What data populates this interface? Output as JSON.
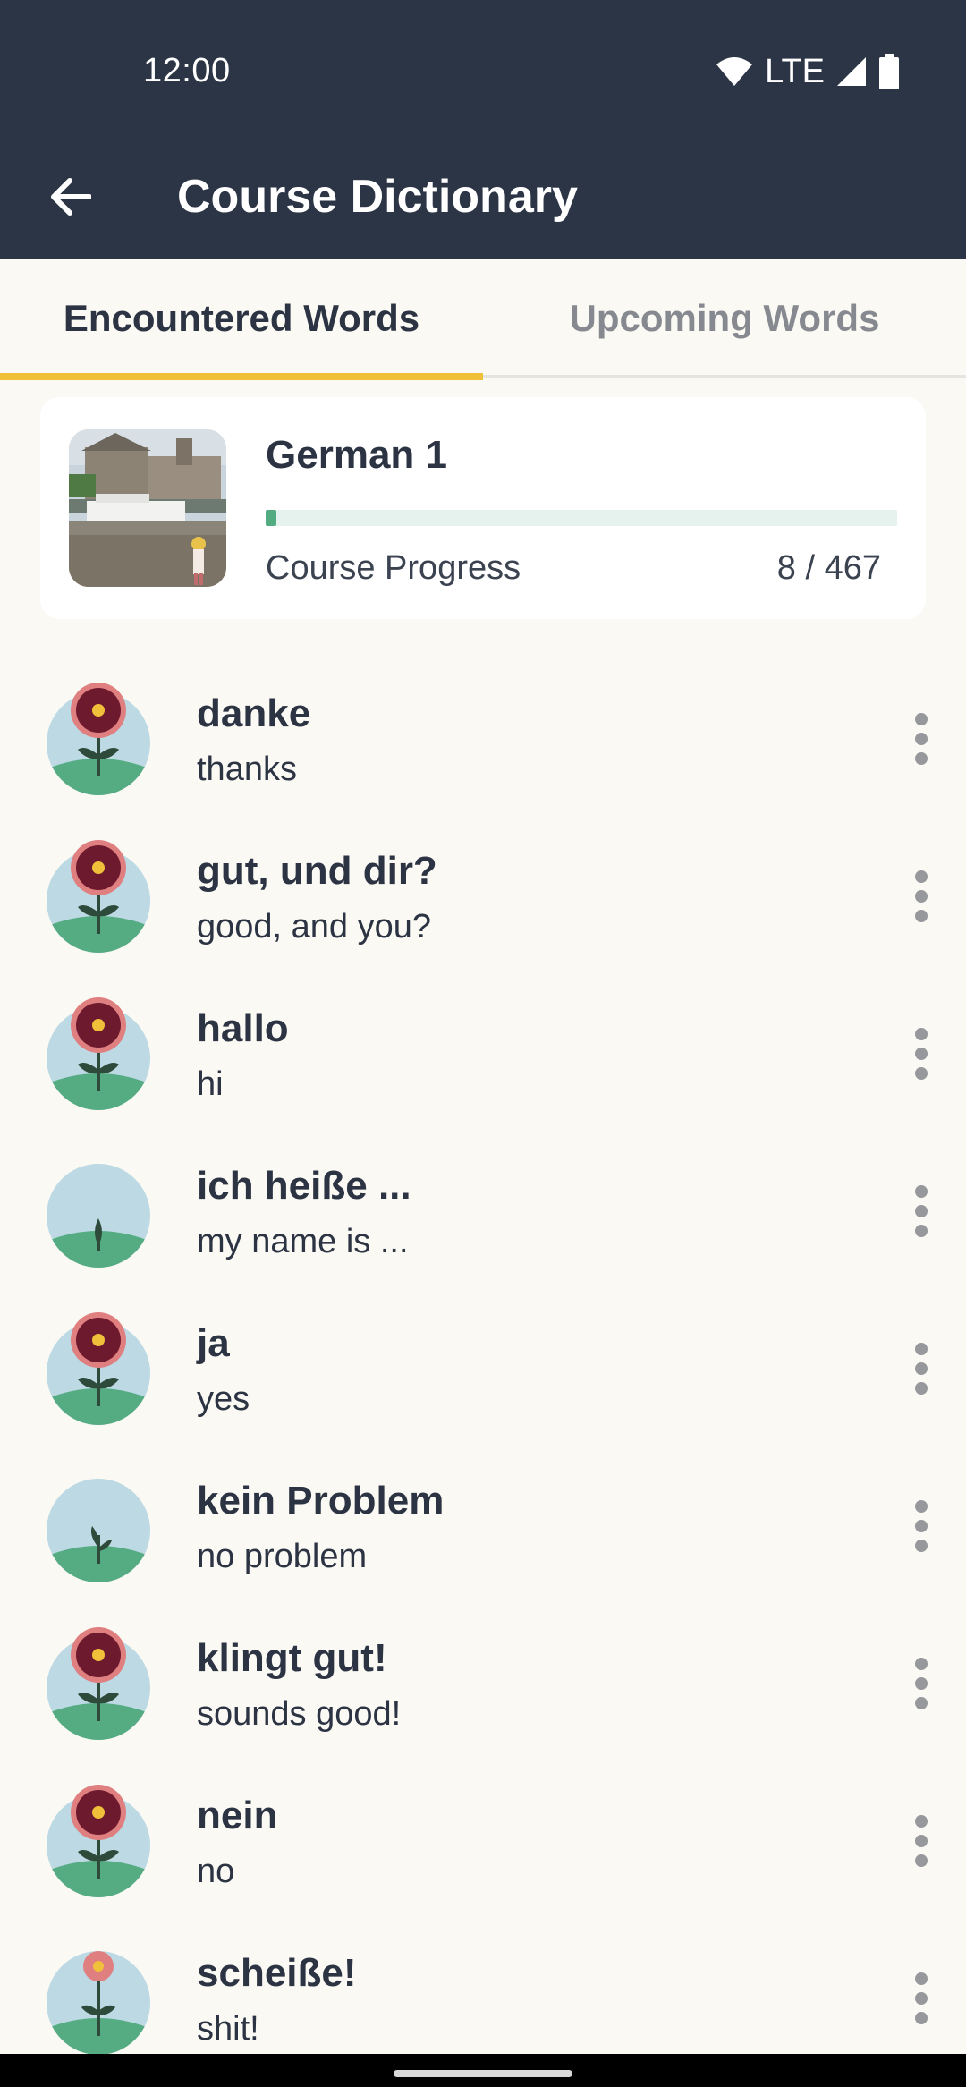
{
  "status_bar": {
    "time": "12:00",
    "network": "LTE",
    "icons": [
      "wifi-icon",
      "signal-icon",
      "battery-icon"
    ]
  },
  "app_bar": {
    "title": "Course Dictionary",
    "back_icon": "arrow-left-icon"
  },
  "tabs": [
    {
      "label": "Encountered Words",
      "active": true
    },
    {
      "label": "Upcoming Words",
      "active": false
    }
  ],
  "course": {
    "title": "German 1",
    "progress_label": "Course Progress",
    "progress_text": "8 / 467",
    "progress_fraction": 0.0171
  },
  "words": [
    {
      "term": "danke",
      "translation": "thanks",
      "stage": "flower"
    },
    {
      "term": "gut, und dir?",
      "translation": "good, and you?",
      "stage": "flower"
    },
    {
      "term": "hallo",
      "translation": "hi",
      "stage": "flower"
    },
    {
      "term": "ich heiße ...",
      "translation": "my name is ...",
      "stage": "sprout"
    },
    {
      "term": "ja",
      "translation": "yes",
      "stage": "flower"
    },
    {
      "term": "kein Problem",
      "translation": "no problem",
      "stage": "seedling"
    },
    {
      "term": "klingt gut!",
      "translation": "sounds good!",
      "stage": "flower"
    },
    {
      "term": "nein",
      "translation": "no",
      "stage": "flower"
    },
    {
      "term": "scheiße!",
      "translation": "shit!",
      "stage": "bud"
    }
  ],
  "colors": {
    "header": "#2c3545",
    "background": "#faf9f3",
    "tab_indicator": "#f0c03a",
    "progress": "#53ab82",
    "flower": "#6e1a2e",
    "flower_ring": "#e07f80",
    "sky": "#bcd9e4",
    "ground": "#55ab82"
  }
}
